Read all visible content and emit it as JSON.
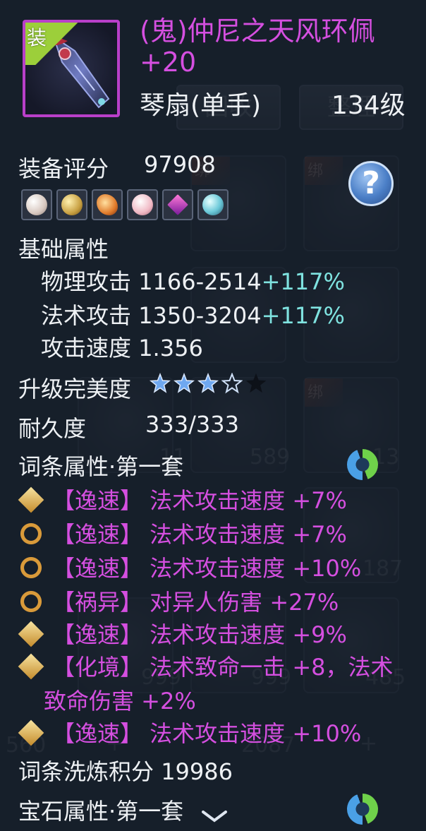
{
  "item": {
    "name": "(鬼)仲尼之天风环佩 +20",
    "type": "琴扇(单手)",
    "level": "134级",
    "tag": "装"
  },
  "score": {
    "label": "装备评分",
    "value": "97908"
  },
  "gems": [
    "pearl-gem-icon",
    "gold-orb-gem-icon",
    "amber-gem-icon",
    "pink-pearl-gem-icon",
    "purple-crystal-gem-icon",
    "aqua-orb-gem-icon"
  ],
  "base": {
    "title": "基础属性",
    "physical": {
      "label": "物理攻击",
      "value": "1166-2514",
      "bonus": "+117%"
    },
    "magic": {
      "label": "法术攻击",
      "value": "1350-3204",
      "bonus": "+117%"
    },
    "speed": {
      "label": "攻击速度",
      "value": "1.356"
    }
  },
  "upgrade": {
    "label": "升级完美度",
    "stars_filled": 3,
    "stars_outline": 1,
    "stars_empty": 1
  },
  "durability": {
    "label": "耐久度",
    "value": "333/333"
  },
  "affix_set": {
    "title": "词条属性·第一套"
  },
  "affixes": [
    {
      "icon": "diamond-icon",
      "text": "【逸速】 法术攻击速度 +7%"
    },
    {
      "icon": "swirl-icon",
      "text": "【逸速】 法术攻击速度 +7%"
    },
    {
      "icon": "swirl-icon",
      "text": "【逸速】 法术攻击速度 +10%"
    },
    {
      "icon": "swirl-icon",
      "text": "【祸异】 对异人伤害 +27%"
    },
    {
      "icon": "diamond-icon",
      "text": "【逸速】 法术攻击速度 +9%"
    },
    {
      "icon": "diamond-icon",
      "text": "【化境】 法术致命一击 +8，法术"
    },
    {
      "icon": "diamond-icon",
      "text": "【逸速】 法术攻击速度 +10%"
    }
  ],
  "affix_wrap": "致命伤害 +2%",
  "refine": {
    "label": "词条洗炼积分",
    "value": "19986"
  },
  "gem_set": {
    "title": "宝石属性·第一套"
  },
  "background": {
    "buttons": [
      "回收",
      "整理"
    ],
    "tags": [
      "绑",
      "绑",
      "绑"
    ],
    "counts": [
      "11",
      "589",
      "13",
      "187",
      "999",
      "999",
      "485",
      "560",
      "2087",
      "+",
      "+"
    ]
  },
  "colors": {
    "purple": "#d54fe0",
    "cyan_bonus": "#7fe3e0",
    "white": "#eef1f4"
  }
}
